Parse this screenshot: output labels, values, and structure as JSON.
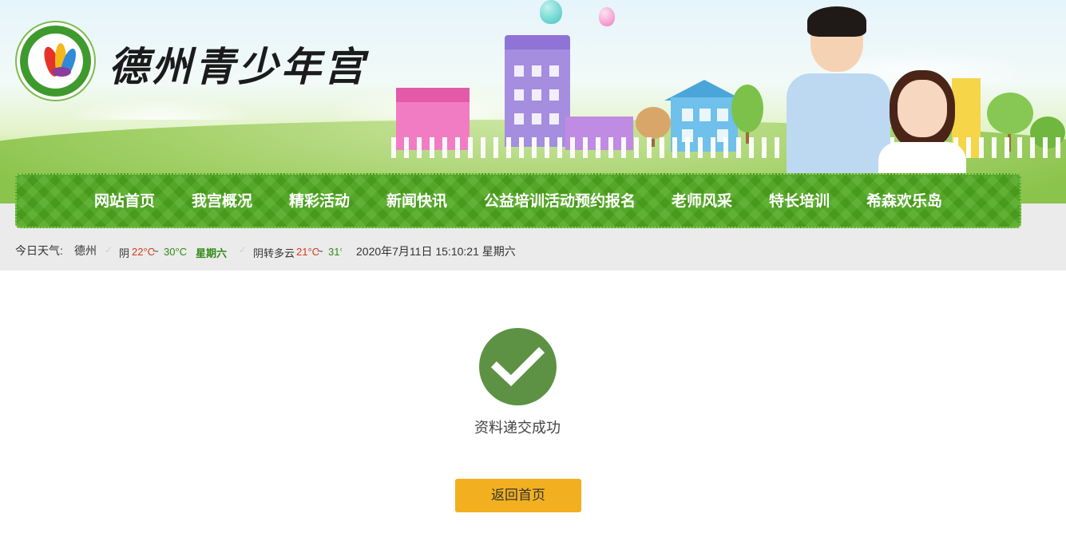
{
  "header": {
    "site_title": "德州青少年宫",
    "logo_icon": "deyouth-palace-logo-icon"
  },
  "nav": {
    "items": [
      {
        "label": "网站首页"
      },
      {
        "label": "我宫概况"
      },
      {
        "label": "精彩活动"
      },
      {
        "label": "新闻快讯"
      },
      {
        "label": "公益培训活动预约报名"
      },
      {
        "label": "老师风采"
      },
      {
        "label": "特长培训"
      },
      {
        "label": "希森欢乐岛"
      }
    ],
    "color": "#4ea71e"
  },
  "weather": {
    "label": "今日天气:",
    "city": "德州",
    "today": {
      "condition": "阴",
      "low": "22°C",
      "tilde": "~",
      "high": "30°C",
      "day": "星期六"
    },
    "tomorrow": {
      "condition": "阴转多云",
      "low": "21°C",
      "tilde": "~",
      "high": "31°"
    },
    "datetime": "2020年7月11日 15:10:21 星期六"
  },
  "result": {
    "icon": "check-icon",
    "message": "资料递交成功",
    "button_label": "返回首页",
    "icon_color": "#5d9244",
    "button_color": "#f2b020"
  }
}
